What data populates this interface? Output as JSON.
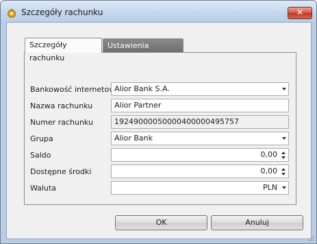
{
  "window": {
    "title": "Szczegóły rachunku",
    "close_label": "✕"
  },
  "tabs": [
    {
      "label": "Szczegóły rachunku",
      "active": true
    },
    {
      "label": "Ustawienia rachunku",
      "active": false
    }
  ],
  "form": {
    "bankowosc": {
      "label": "Bankowość internetowa",
      "value": "Alior Bank S.A."
    },
    "nazwa": {
      "label": "Nazwa rachunku",
      "value": "Alior Partner"
    },
    "numer": {
      "label": "Numer rachunku",
      "value": "19249000050000400000495757"
    },
    "grupa": {
      "label": "Grupa",
      "value": "Alior Bank"
    },
    "saldo": {
      "label": "Saldo",
      "value": "0,00"
    },
    "srodki": {
      "label": "Dostępne środki",
      "value": "0,00"
    },
    "waluta": {
      "label": "Waluta",
      "value": "PLN"
    }
  },
  "buttons": {
    "ok": "OK",
    "cancel": "Anuluj"
  },
  "colors": {
    "close_button": "#d7553f",
    "inactive_tab": "#7a7a7a",
    "window_frame": "#b8cce6"
  }
}
